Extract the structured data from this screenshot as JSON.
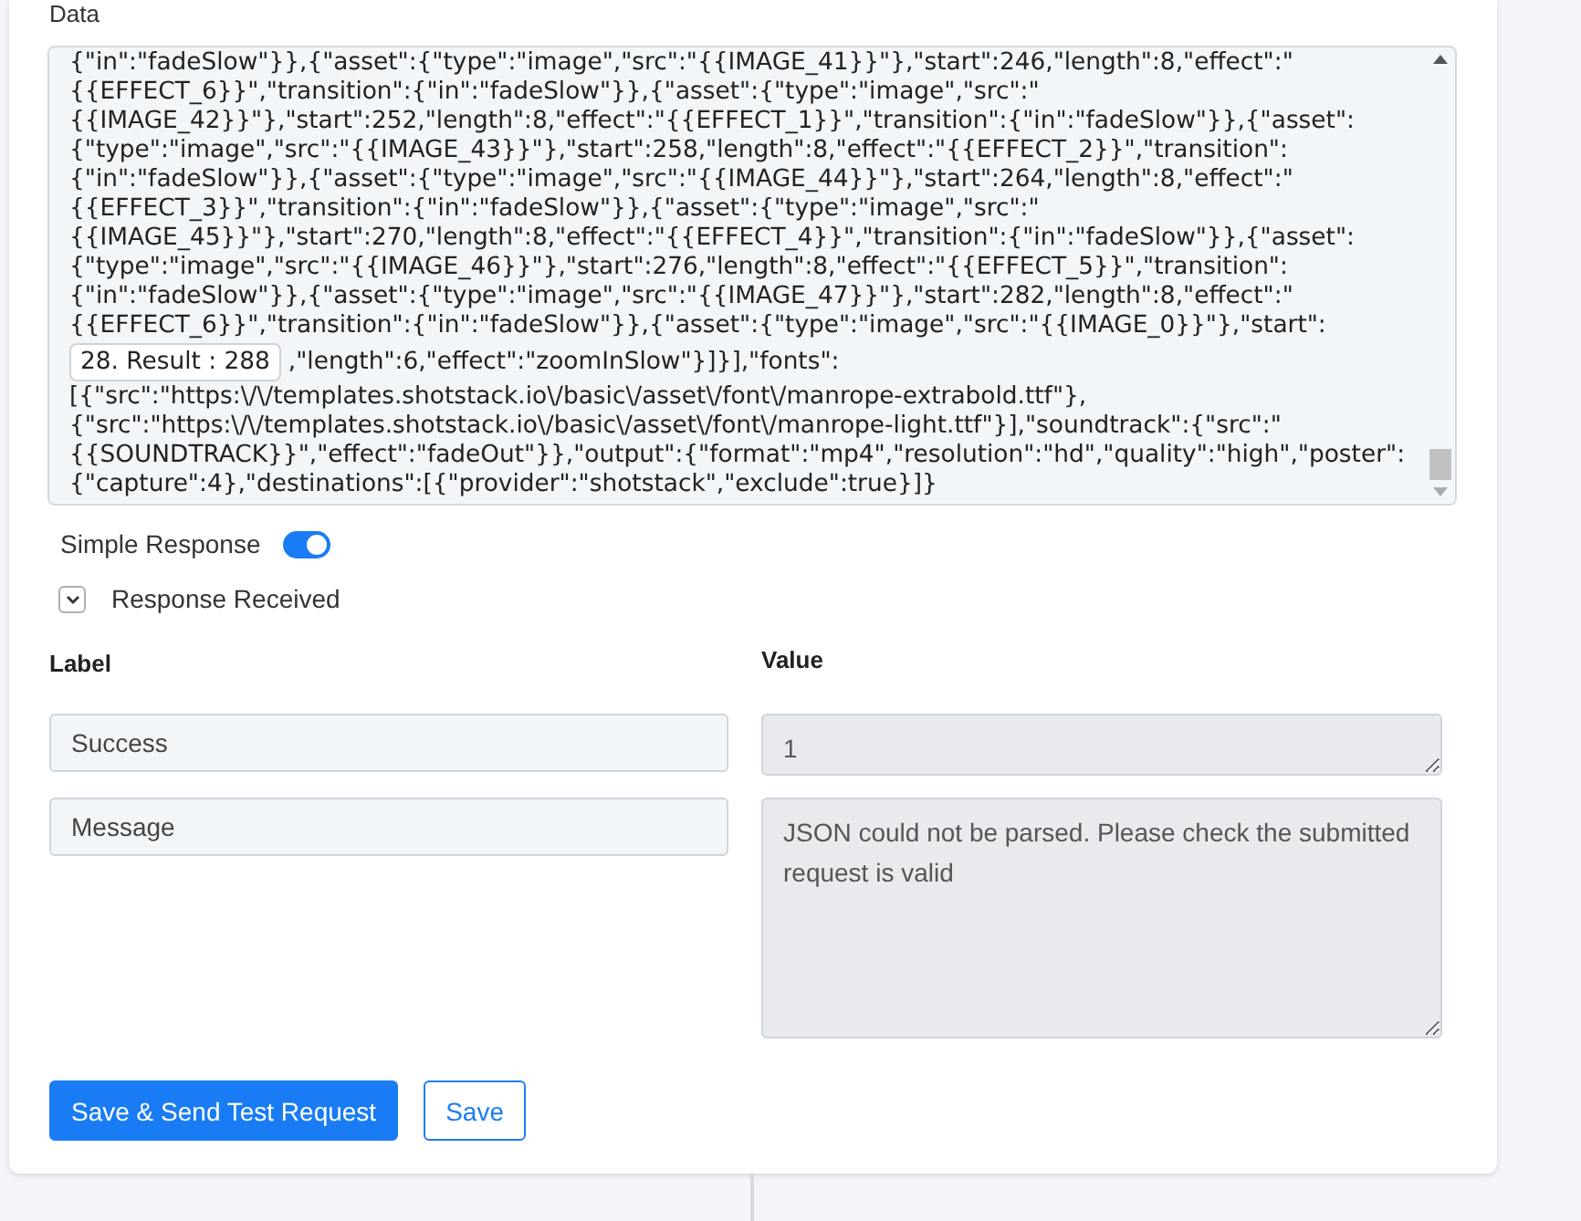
{
  "data_field": {
    "label": "Data",
    "lines": [
      {
        "kind": "text",
        "text": "{\"in\":\"fadeSlow\"}},{\"asset\":{\"type\":\"image\",\"src\":\"{{IMAGE_41}}\"},\"start\":246,\"length\":8,\"effect\":\""
      },
      {
        "kind": "text",
        "text": "{{EFFECT_6}}\",\"transition\":{\"in\":\"fadeSlow\"}},{\"asset\":{\"type\":\"image\",\"src\":\""
      },
      {
        "kind": "text",
        "text": "{{IMAGE_42}}\"},\"start\":252,\"length\":8,\"effect\":\"{{EFFECT_1}}\",\"transition\":{\"in\":\"fadeSlow\"}},{\"asset\":"
      },
      {
        "kind": "text",
        "text": "{\"type\":\"image\",\"src\":\"{{IMAGE_43}}\"},\"start\":258,\"length\":8,\"effect\":\"{{EFFECT_2}}\",\"transition\":"
      },
      {
        "kind": "text",
        "text": "{\"in\":\"fadeSlow\"}},{\"asset\":{\"type\":\"image\",\"src\":\"{{IMAGE_44}}\"},\"start\":264,\"length\":8,\"effect\":\""
      },
      {
        "kind": "text",
        "text": "{{EFFECT_3}}\",\"transition\":{\"in\":\"fadeSlow\"}},{\"asset\":{\"type\":\"image\",\"src\":\""
      },
      {
        "kind": "text",
        "text": "{{IMAGE_45}}\"},\"start\":270,\"length\":8,\"effect\":\"{{EFFECT_4}}\",\"transition\":{\"in\":\"fadeSlow\"}},{\"asset\":"
      },
      {
        "kind": "text",
        "text": "{\"type\":\"image\",\"src\":\"{{IMAGE_46}}\"},\"start\":276,\"length\":8,\"effect\":\"{{EFFECT_5}}\",\"transition\":"
      },
      {
        "kind": "text",
        "text": "{\"in\":\"fadeSlow\"}},{\"asset\":{\"type\":\"image\",\"src\":\"{{IMAGE_47}}\"},\"start\":282,\"length\":8,\"effect\":\""
      },
      {
        "kind": "text",
        "text": "{{EFFECT_6}}\",\"transition\":{\"in\":\"fadeSlow\"}},{\"asset\":{\"type\":\"image\",\"src\":\"{{IMAGE_0}}\"},\"start\":"
      },
      {
        "kind": "chip",
        "chip": "28. Result : 288",
        "text": ",\"length\":6,\"effect\":\"zoomInSlow\"}]}],\"fonts\":"
      },
      {
        "kind": "text",
        "text": "[{\"src\":\"https:\\/\\/templates.shotstack.io\\/basic\\/asset\\/font\\/manrope-extrabold.ttf\"},"
      },
      {
        "kind": "text",
        "text": "{\"src\":\"https:\\/\\/templates.shotstack.io\\/basic\\/asset\\/font\\/manrope-light.ttf\"}],\"soundtrack\":{\"src\":\""
      },
      {
        "kind": "text",
        "text": "{{SOUNDTRACK}}\",\"effect\":\"fadeOut\"}},\"output\":{\"format\":\"mp4\",\"resolution\":\"hd\",\"quality\":\"high\",\"poster\":"
      },
      {
        "kind": "text",
        "text": "{\"capture\":4},\"destinations\":[{\"provider\":\"shotstack\",\"exclude\":true}]}"
      }
    ]
  },
  "simple_response": {
    "label": "Simple Response",
    "on": true
  },
  "response_received": {
    "label": "Response Received",
    "expanded": true
  },
  "table": {
    "columns": [
      "Label",
      "Value"
    ],
    "rows": [
      {
        "label": "Success",
        "value": "1",
        "kind": "short"
      },
      {
        "label": "Message",
        "value": "JSON could not be parsed. Please check the submitted request is valid",
        "kind": "tall"
      }
    ]
  },
  "buttons": [
    {
      "label": "Save & Send Test Request",
      "kind": "primary"
    },
    {
      "label": "Save",
      "kind": "outline"
    }
  ]
}
